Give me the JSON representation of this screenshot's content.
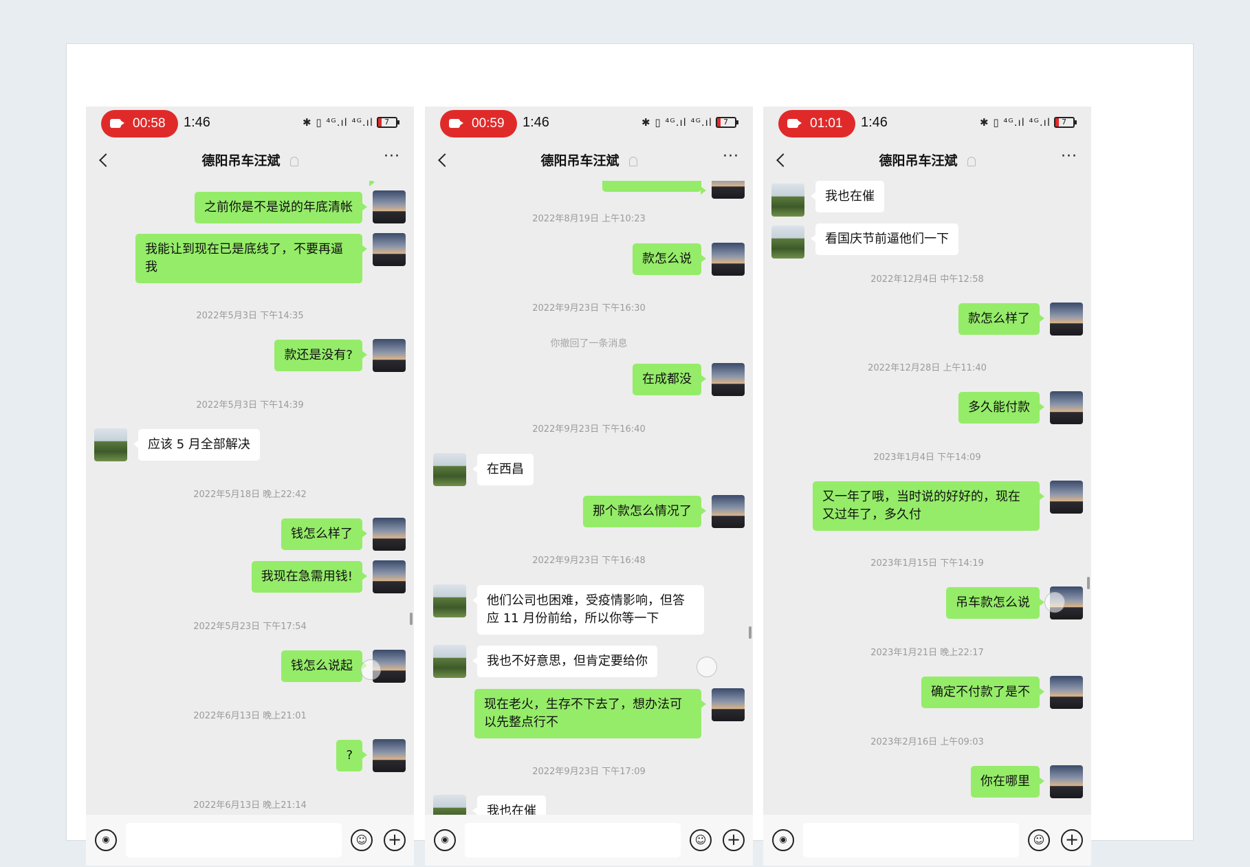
{
  "colors": {
    "recording": "#e02a2a",
    "me_bubble": "#95ec69",
    "them_bubble": "#ffffff",
    "chat_bg": "#ededed"
  },
  "icons": [
    "video-camera-icon",
    "bluetooth-icon",
    "vibrate-icon",
    "signal-icon",
    "battery-icon",
    "back-icon",
    "mute-icon",
    "more-icon",
    "voice-icon",
    "emoji-icon",
    "plus-icon"
  ],
  "phones": [
    {
      "record_time": "00:58",
      "clock": "1:46",
      "sys": "✱ ▯ ⁴ᴳ.ıl ⁴ᴳ.ıl",
      "battery": "7",
      "title": "德阳吊车汪斌",
      "more": "···",
      "messages": [
        {
          "text": "之前你是不是说的年底清帐"
        },
        {
          "text": "我能让到现在已是底线了，不要再逼我"
        },
        {
          "text": "2022年5月3日 下午14:35"
        },
        {
          "text": "款还是没有?"
        },
        {
          "text": "2022年5月3日 下午14:39"
        },
        {
          "text": "应该 5 月全部解决"
        },
        {
          "text": "2022年5月18日 晚上22:42"
        },
        {
          "text": "钱怎么样了"
        },
        {
          "text": "我现在急需用钱!"
        },
        {
          "text": "2022年5月23日 下午17:54"
        },
        {
          "text": "钱怎么说起"
        },
        {
          "text": "2022年6月13日 晚上21:01"
        },
        {
          "text": "?"
        },
        {
          "text": "2022年6月13日 晚上21:14"
        }
      ]
    },
    {
      "record_time": "00:59",
      "clock": "1:46",
      "sys": "✱ ▯ ⁴ᴳ.ıl ⁴ᴳ.ıl",
      "battery": "7",
      "title": "德阳吊车汪斌",
      "more": "···",
      "messages": [
        {
          "text": "2022年8月19日 上午10:23"
        },
        {
          "text": "款怎么说"
        },
        {
          "text": "2022年9月23日 下午16:30"
        },
        {
          "text": "你撤回了一条消息"
        },
        {
          "text": "在成都没"
        },
        {
          "text": "2022年9月23日 下午16:40"
        },
        {
          "text": "在西昌"
        },
        {
          "text": "那个款怎么情况了"
        },
        {
          "text": "2022年9月23日 下午16:48"
        },
        {
          "text": "他们公司也困难，受疫情影响，但答应 11 月份前给，所以你等一下"
        },
        {
          "text": "我也不好意思，但肯定要给你"
        },
        {
          "text": "现在老火，生存不下去了，想办法可以先整点行不"
        },
        {
          "text": "2022年9月23日 下午17:09"
        },
        {
          "text": "我也在催"
        }
      ]
    },
    {
      "record_time": "01:01",
      "clock": "1:46",
      "sys": "✱ ▯ ⁴ᴳ.ıl ⁴ᴳ.ıl",
      "battery": "7",
      "title": "德阳吊车汪斌",
      "more": "···",
      "messages": [
        {
          "text": "我也在催"
        },
        {
          "text": "看国庆节前逼他们一下"
        },
        {
          "text": "2022年12月4日 中午12:58"
        },
        {
          "text": "款怎么样了"
        },
        {
          "text": "2022年12月28日 上午11:40"
        },
        {
          "text": "多久能付款"
        },
        {
          "text": "2023年1月4日 下午14:09"
        },
        {
          "text": "又一年了哦，当时说的好好的，现在又过年了，多久付"
        },
        {
          "text": "2023年1月15日 下午14:19"
        },
        {
          "text": "吊车款怎么说"
        },
        {
          "text": "2023年1月21日 晚上22:17"
        },
        {
          "text": "确定不付款了是不"
        },
        {
          "text": "2023年2月16日 上午09:03"
        },
        {
          "text": "你在哪里"
        }
      ]
    }
  ]
}
